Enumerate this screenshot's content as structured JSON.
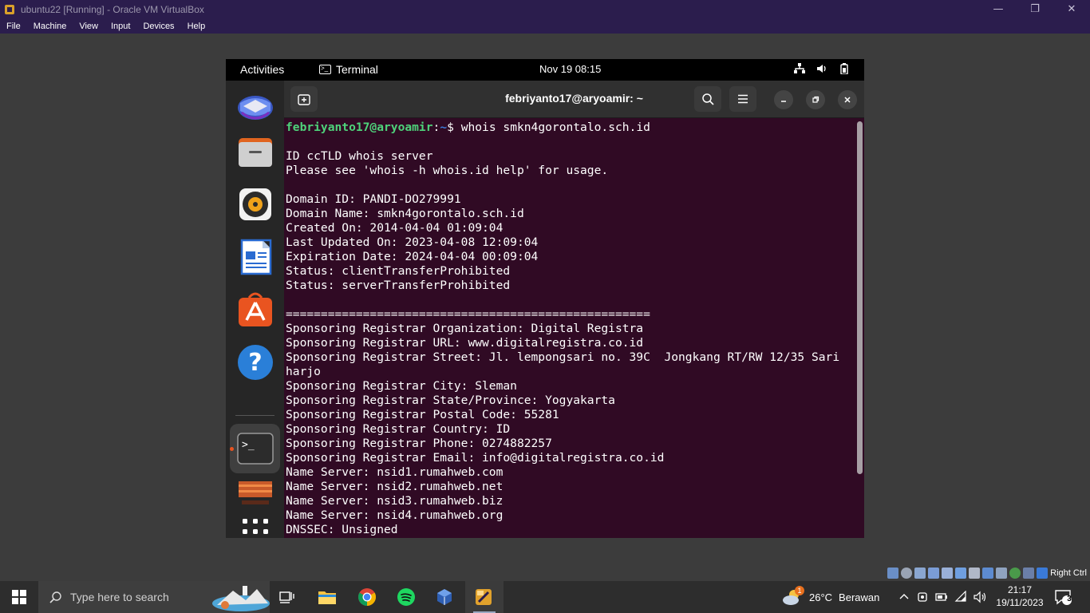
{
  "host": {
    "title": "ubuntu22 [Running] - Oracle VM VirtualBox",
    "menu": [
      "File",
      "Machine",
      "View",
      "Input",
      "Devices",
      "Help"
    ],
    "status_right_ctrl": "Right Ctrl"
  },
  "gnome": {
    "activities": "Activities",
    "app_name": "Terminal",
    "clock": "Nov 19  08:15"
  },
  "terminal": {
    "title": "febriyanto17@aryoamir: ~",
    "prompt_user": "febriyanto17@aryoamir",
    "prompt_sep": ":",
    "prompt_path": "~",
    "prompt_end": "$ ",
    "command": "whois smkn4gorontalo.sch.id",
    "output": [
      "",
      "ID ccTLD whois server",
      "Please see 'whois -h whois.id help' for usage.",
      "",
      "Domain ID: PANDI-DO279991",
      "Domain Name: smkn4gorontalo.sch.id",
      "Created On: 2014-04-04 01:09:04",
      "Last Updated On: 2023-04-08 12:09:04",
      "Expiration Date: 2024-04-04 00:09:04",
      "Status: clientTransferProhibited",
      "Status: serverTransferProhibited",
      "",
      "====================================================",
      "Sponsoring Registrar Organization: Digital Registra",
      "Sponsoring Registrar URL: www.digitalregistra.co.id",
      "Sponsoring Registrar Street: Jl. lempongsari no. 39C  Jongkang RT/RW 12/35 Sari",
      "harjo",
      "Sponsoring Registrar City: Sleman",
      "Sponsoring Registrar State/Province: Yogyakarta",
      "Sponsoring Registrar Postal Code: 55281",
      "Sponsoring Registrar Country: ID",
      "Sponsoring Registrar Phone: 0274882257",
      "Sponsoring Registrar Email: info@digitalregistra.co.id",
      "Name Server: nsid1.rumahweb.com",
      "Name Server: nsid2.rumahweb.net",
      "Name Server: nsid3.rumahweb.biz",
      "Name Server: nsid4.rumahweb.org",
      "DNSSEC: Unsigned"
    ]
  },
  "taskbar": {
    "search_placeholder": "Type here to search",
    "weather_temp": "26°C",
    "weather_desc": "Berawan",
    "weather_badge": "1",
    "time": "21:17",
    "date": "19/11/2023",
    "notification_count": "3"
  },
  "colors": {
    "terminal_bg": "#300a24",
    "prompt_user": "#4ed27a",
    "prompt_path": "#3b7bd8",
    "ubuntu_accent": "#e95420"
  }
}
